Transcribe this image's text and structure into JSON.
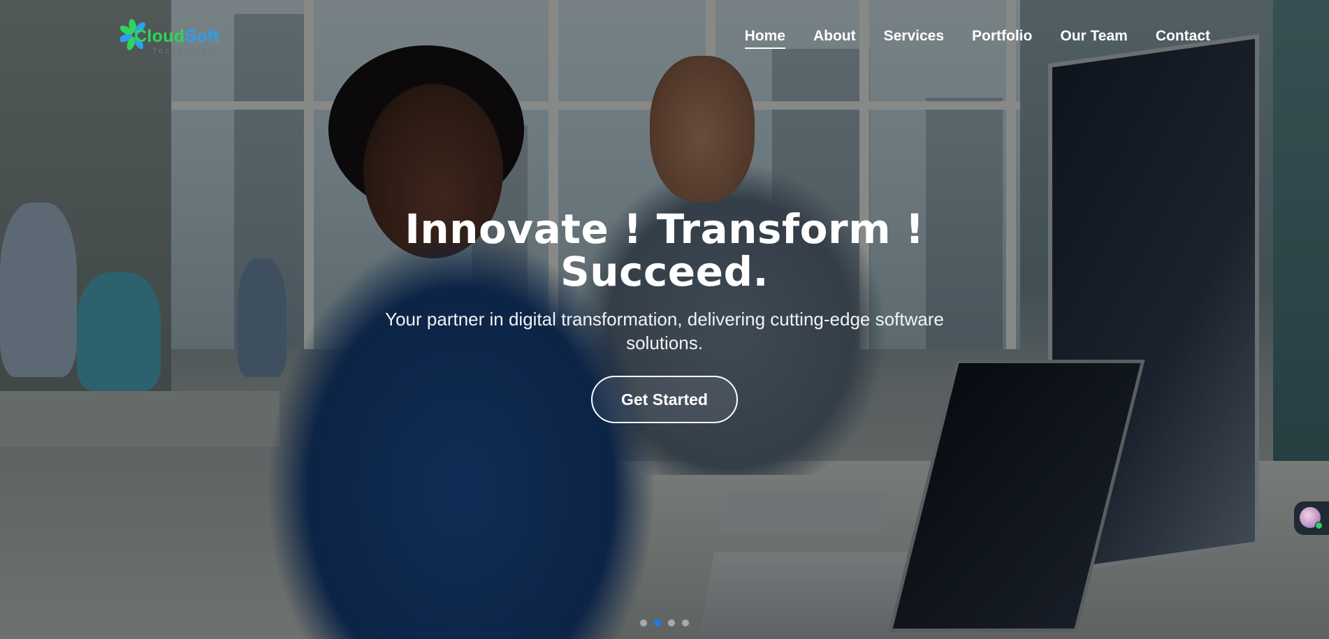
{
  "brand": {
    "logo_word1": "Cloud",
    "logo_word2": "Soft",
    "logo_tagline": "Technology",
    "logo_icon": "leaf-icon",
    "colors": {
      "logo_green": "#2dd55b",
      "logo_blue": "#2ba1e8",
      "accent_dot": "#1b7cf0"
    }
  },
  "nav": {
    "items": [
      {
        "label": "Home",
        "active": true
      },
      {
        "label": "About",
        "active": false
      },
      {
        "label": "Services",
        "active": false
      },
      {
        "label": "Portfolio",
        "active": false
      },
      {
        "label": "Our Team",
        "active": false
      },
      {
        "label": "Contact",
        "active": false
      }
    ]
  },
  "hero": {
    "title_line1": "Innovate ! Transform !",
    "title_line2": "Succeed.",
    "subtitle": "Your partner in digital transformation, delivering cutting-edge software solutions.",
    "cta_label": "Get Started",
    "background": "office photo with people working at laptops and monitors"
  },
  "carousel": {
    "slide_count": 4,
    "active_index": 1
  },
  "chat_widget": {
    "icon": "chat-avatar-icon",
    "status": "online"
  }
}
